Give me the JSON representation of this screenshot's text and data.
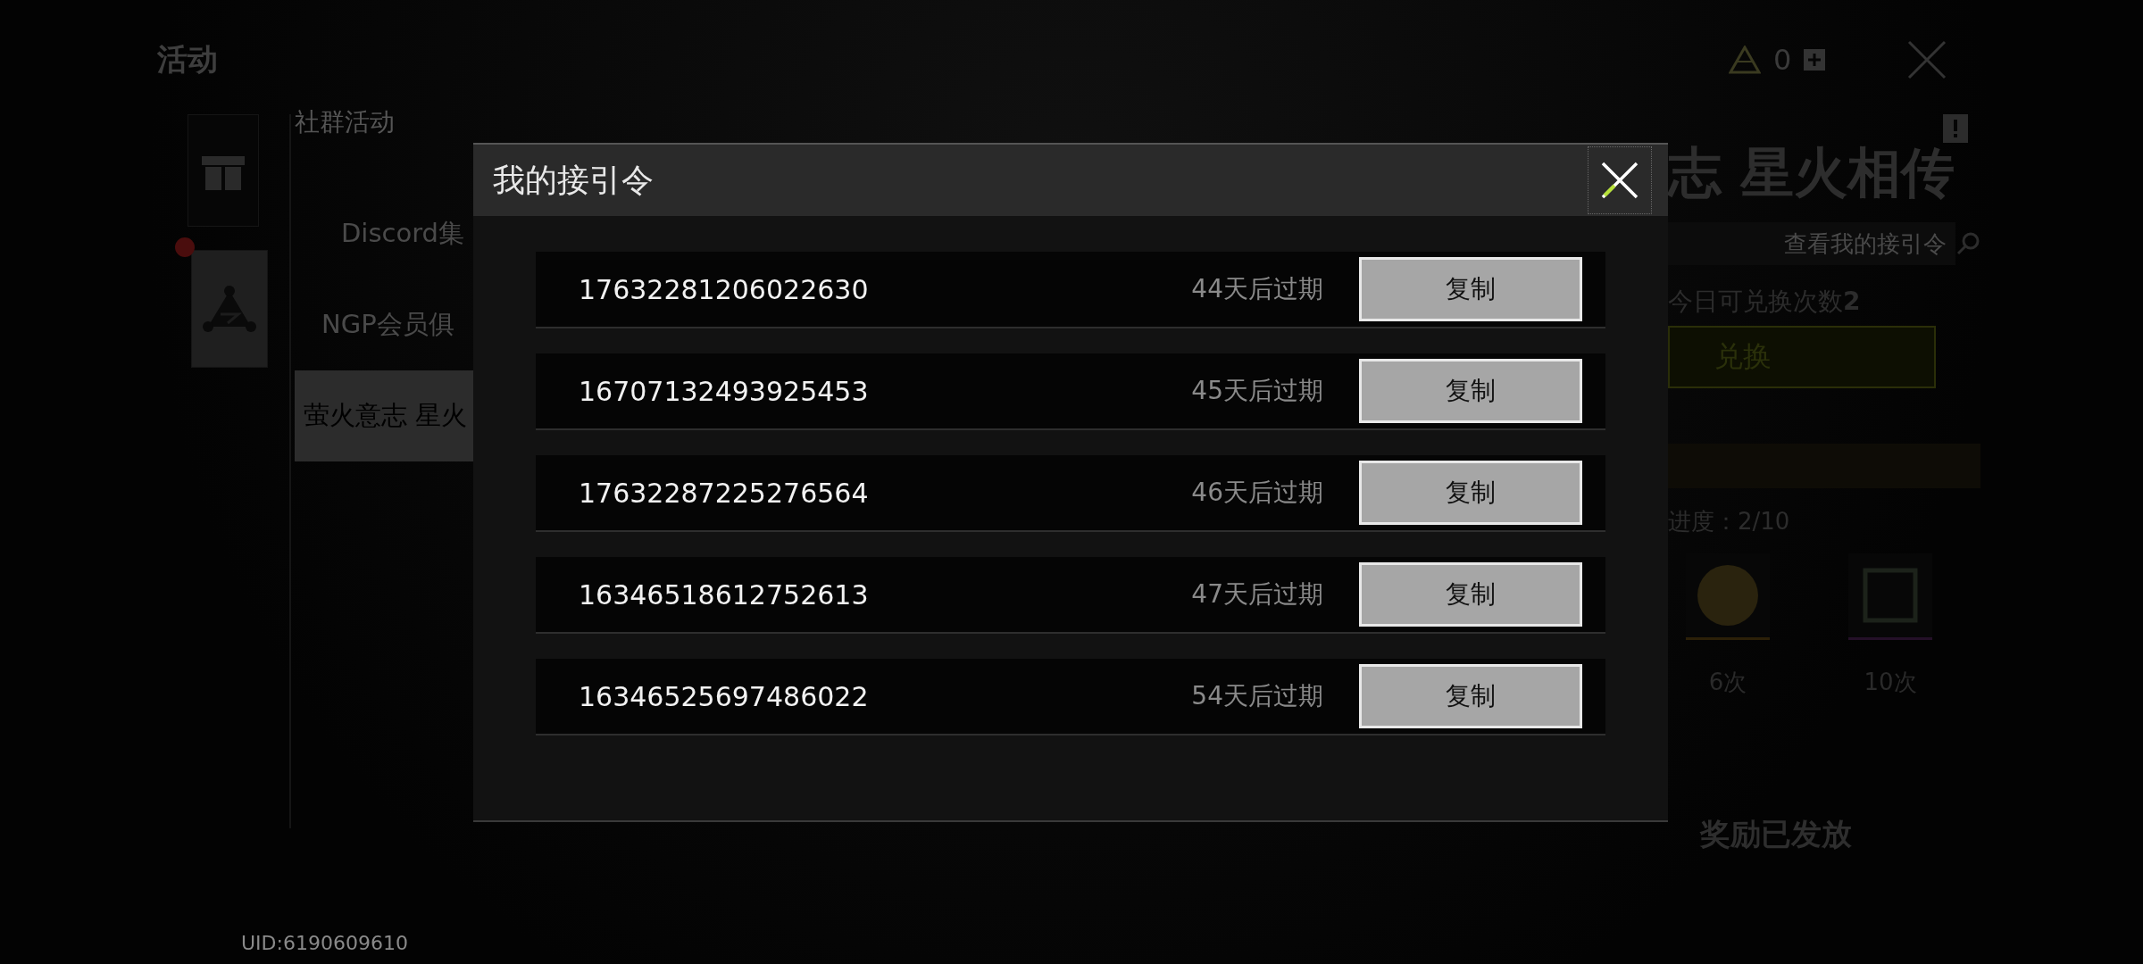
{
  "header": {
    "title": "活动",
    "currency": "0"
  },
  "categories": [
    {
      "kind": "gift",
      "selected": false,
      "alert": false
    },
    {
      "kind": "logo",
      "selected": true,
      "alert": true
    }
  ],
  "section": "社群活动",
  "events": [
    {
      "label": "Discord集",
      "selected": false
    },
    {
      "label": "NGP会员俱",
      "selected": false
    },
    {
      "label": "萤火意志 星火",
      "selected": true
    }
  ],
  "event_panel": {
    "title": "志 星火相传",
    "search": {
      "placeholder": "查看我的接引令"
    },
    "daily_redeem": "今日可兑换次数**2**",
    "redeem_button": "兑换",
    "progress": "进度：2/10",
    "milestones": [
      {
        "label": "6次",
        "kind": "coin"
      },
      {
        "label": "10次",
        "kind": "frame"
      }
    ],
    "status": "奖励已发放"
  },
  "uid": "UID:6190609610",
  "dialog": {
    "title": "我的接引令",
    "codes": [
      {
        "code": "17632281206022630",
        "expiry": "44天后过期",
        "action": "复制"
      },
      {
        "code": "16707132493925453",
        "expiry": "45天后过期",
        "action": "复制"
      },
      {
        "code": "17632287225276564",
        "expiry": "46天后过期",
        "action": "复制"
      },
      {
        "code": "16346518612752613",
        "expiry": "47天后过期",
        "action": "复制"
      },
      {
        "code": "16346525697486022",
        "expiry": "54天后过期",
        "action": "复制"
      }
    ]
  }
}
